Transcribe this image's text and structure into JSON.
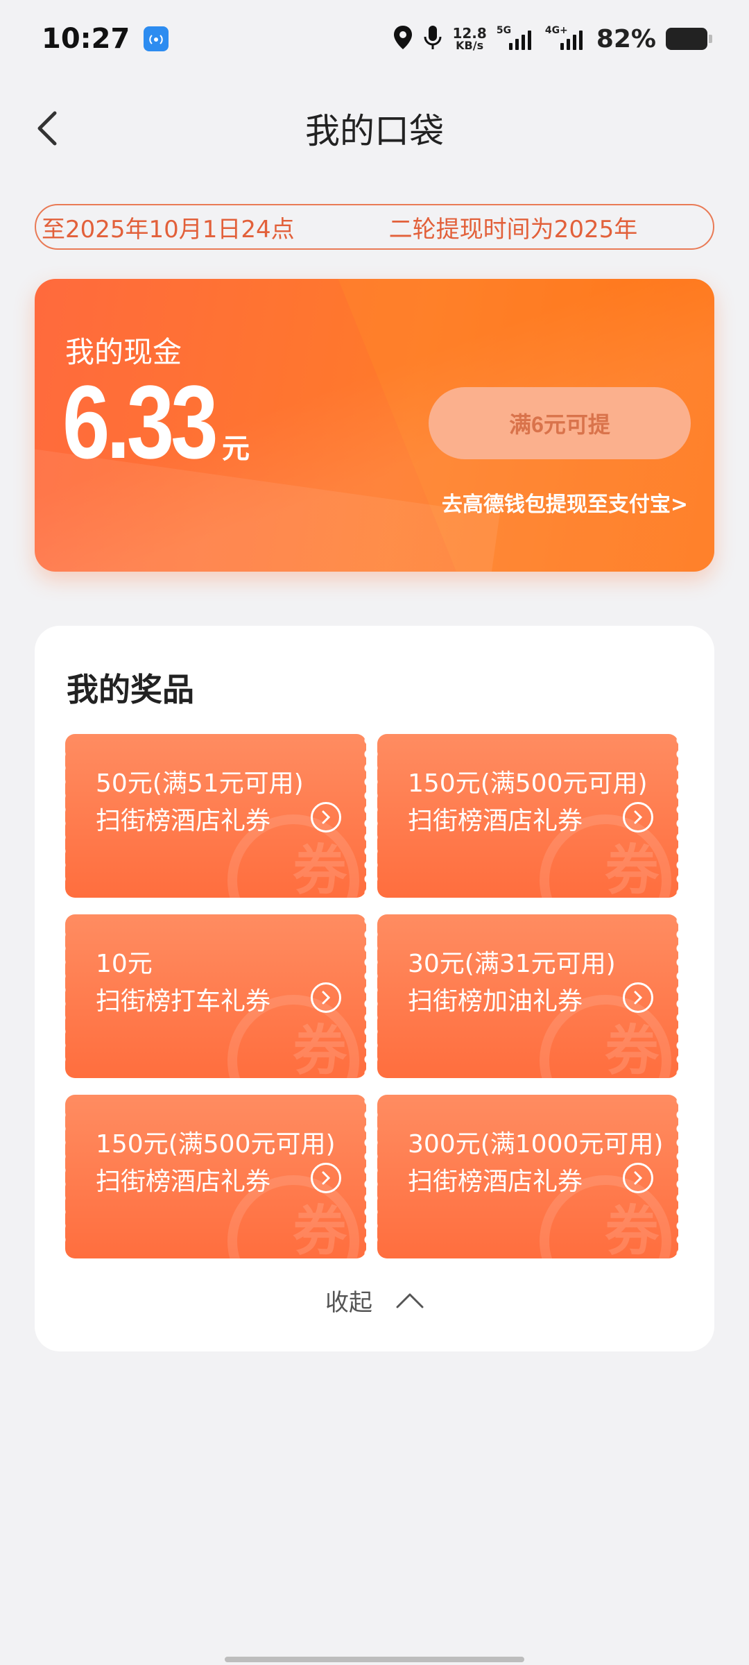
{
  "status_bar": {
    "time": "10:27",
    "net_speed_value": "12.8",
    "net_speed_unit": "KB/s",
    "sim1_label": "5G",
    "sim2_label": "4G+",
    "battery": "82%"
  },
  "header": {
    "title": "我的口袋"
  },
  "notice": {
    "text": "至2025年10月1日24点　　　　二轮提现时间为2025年"
  },
  "cash": {
    "label": "我的现金",
    "amount": "6.33",
    "unit": "元",
    "withdraw_label": "满6元可提",
    "wallet_link": "去高德钱包提现至支付宝>"
  },
  "prizes": {
    "title": "我的奖品",
    "coupons": [
      {
        "amount": "50元(满51元可用)",
        "name": "扫街榜酒店礼券"
      },
      {
        "amount": "150元(满500元可用)",
        "name": "扫街榜酒店礼券"
      },
      {
        "amount": "10元",
        "name": "扫街榜打车礼券"
      },
      {
        "amount": "30元(满31元可用)",
        "name": "扫街榜加油礼券"
      },
      {
        "amount": "150元(满500元可用)",
        "name": "扫街榜酒店礼券"
      },
      {
        "amount": "300元(满1000元可用)",
        "name": "扫街榜酒店礼券"
      }
    ],
    "watermark_char": "券",
    "collapse_label": "收起"
  },
  "colors": {
    "accent": "#ff6a3d",
    "notice_text": "#e2603a",
    "withdraw_bg": "#fbb08d"
  }
}
